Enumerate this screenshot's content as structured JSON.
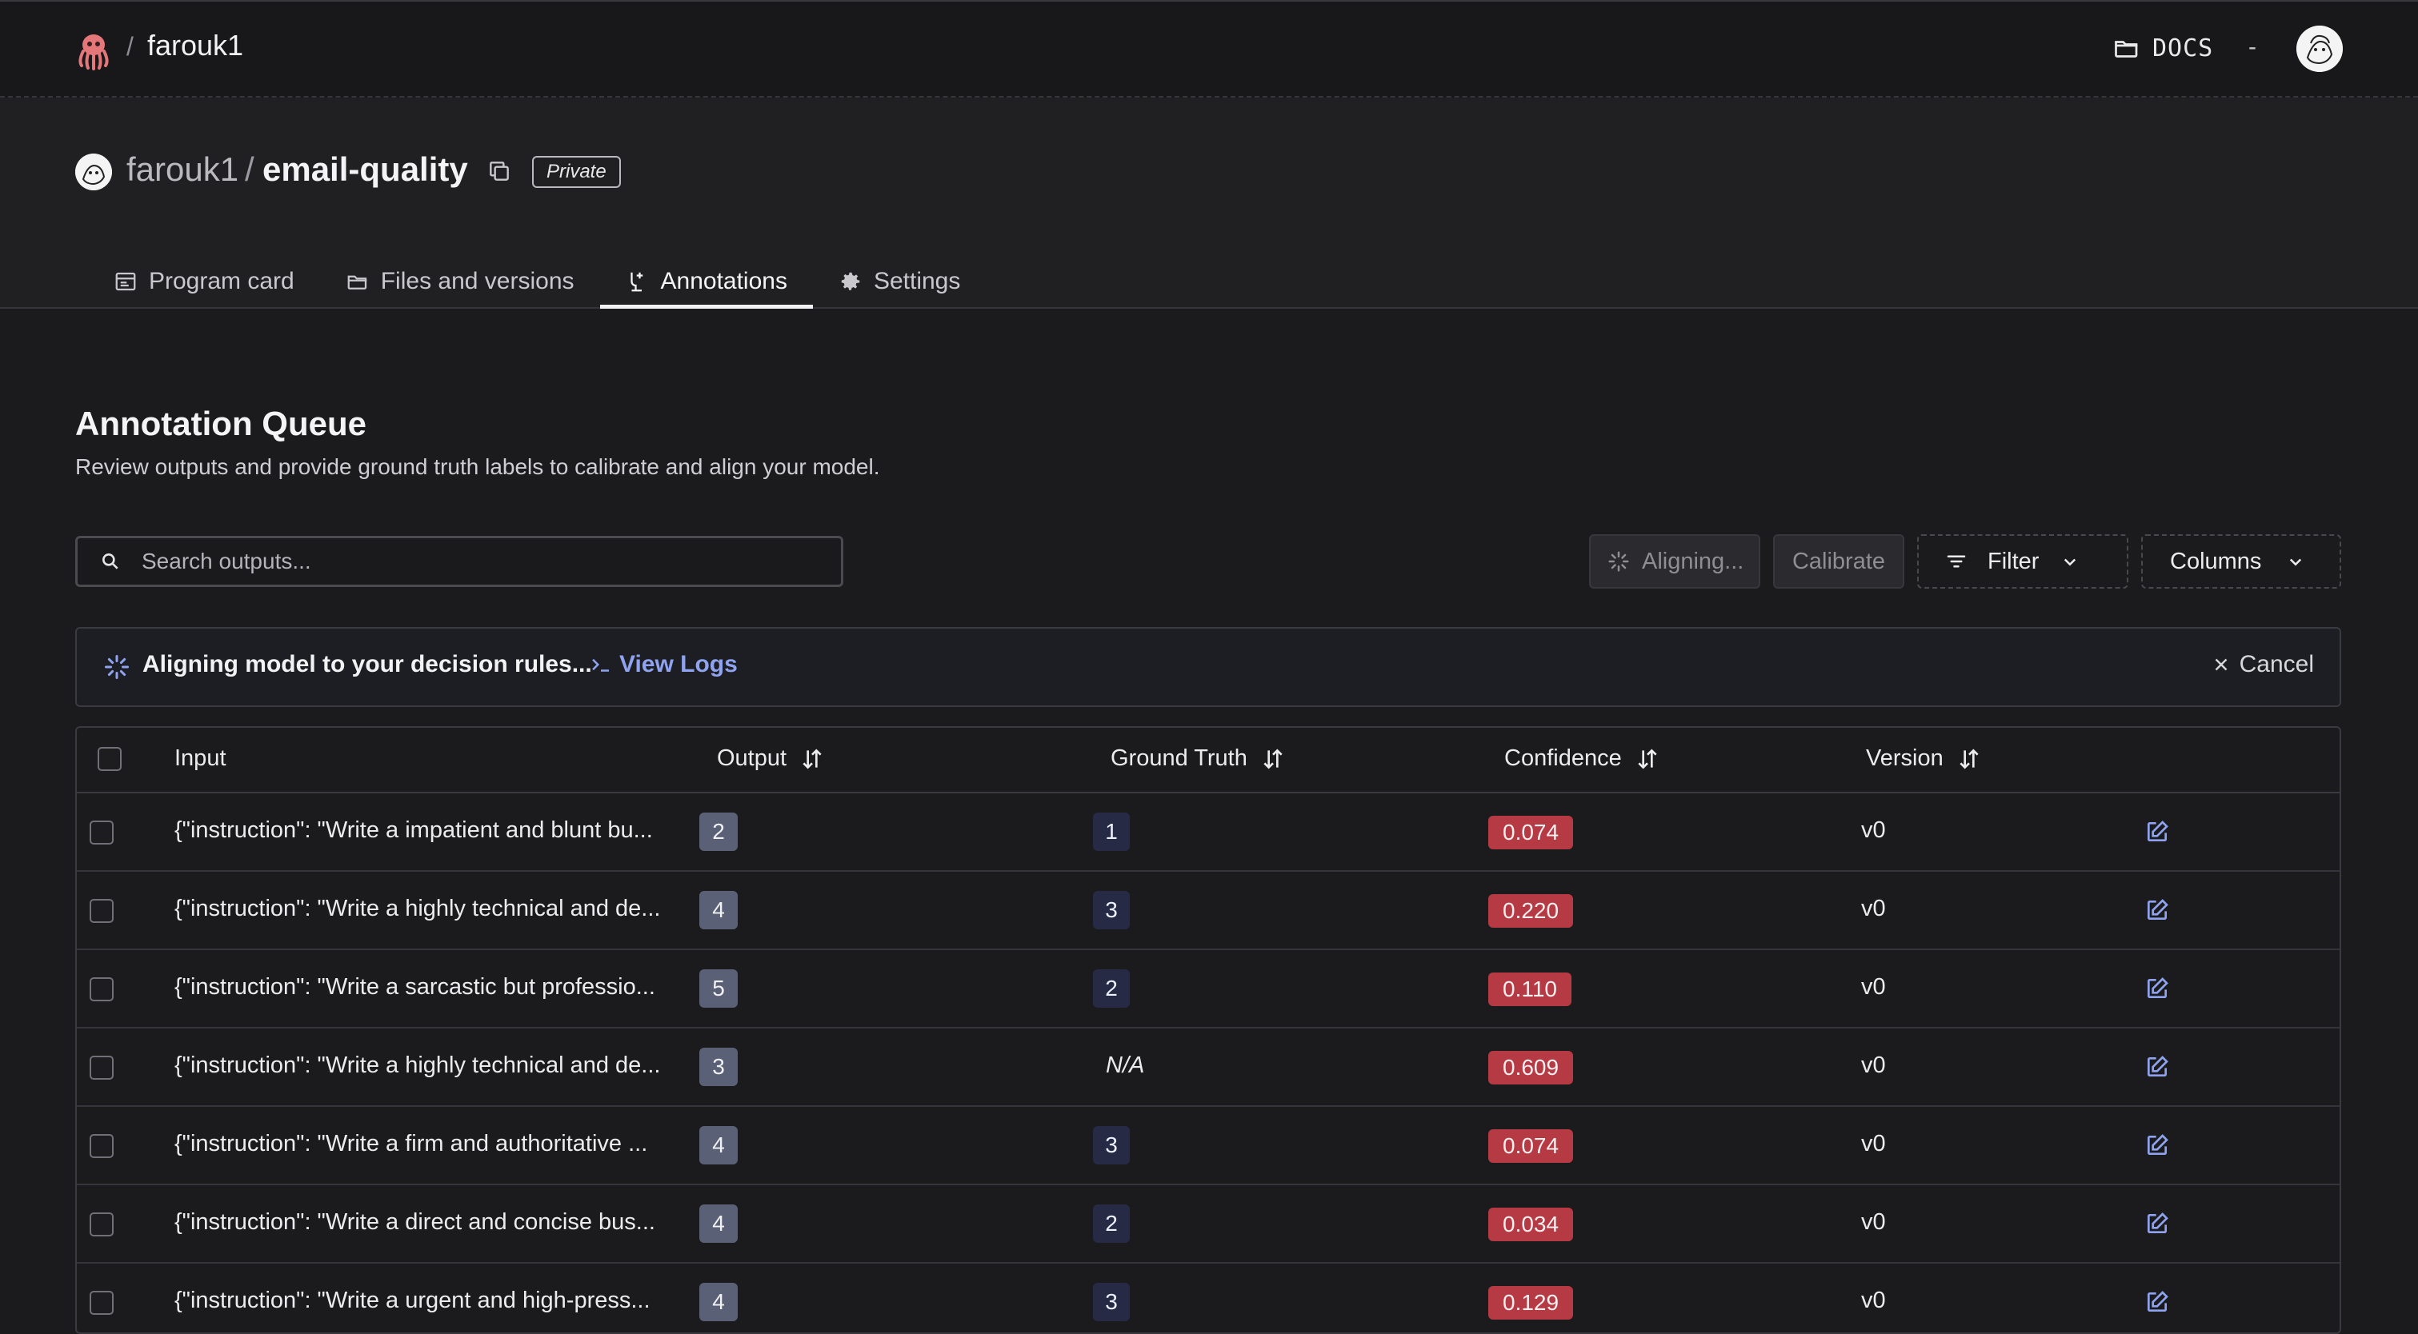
{
  "topnav": {
    "user": "farouk1",
    "docs_label": "DOCS",
    "dash": "-"
  },
  "repo": {
    "owner": "farouk1",
    "separator": "/",
    "name": "email-quality",
    "visibility": "Private"
  },
  "tabs": [
    {
      "label": "Program card",
      "icon": "card-icon"
    },
    {
      "label": "Files and versions",
      "icon": "folder-icon"
    },
    {
      "label": "Annotations",
      "icon": "annotation-icon",
      "active": true
    },
    {
      "label": "Settings",
      "icon": "gear-icon"
    }
  ],
  "main": {
    "title": "Annotation Queue",
    "subtitle": "Review outputs and provide ground truth labels to calibrate and align your model."
  },
  "search": {
    "placeholder": "Search outputs..."
  },
  "toolbar": {
    "aligning_label": "Aligning...",
    "calibrate_label": "Calibrate",
    "filter_label": "Filter",
    "columns_label": "Columns"
  },
  "banner": {
    "message": "Aligning model to your decision rules...",
    "logs_label": "View Logs",
    "cancel_label": "Cancel"
  },
  "table": {
    "headers": {
      "input": "Input",
      "output": "Output",
      "ground_truth": "Ground Truth",
      "confidence": "Confidence",
      "version": "Version"
    },
    "rows": [
      {
        "input": "{\"instruction\": \"Write a impatient and blunt bu...",
        "output": "2",
        "ground_truth": "1",
        "confidence": "0.074",
        "version": "v0"
      },
      {
        "input": "{\"instruction\": \"Write a highly technical and de...",
        "output": "4",
        "ground_truth": "3",
        "confidence": "0.220",
        "version": "v0"
      },
      {
        "input": "{\"instruction\": \"Write a sarcastic but professio...",
        "output": "5",
        "ground_truth": "2",
        "confidence": "0.110",
        "version": "v0"
      },
      {
        "input": "{\"instruction\": \"Write a highly technical and de...",
        "output": "3",
        "ground_truth": "N/A",
        "confidence": "0.609",
        "version": "v0"
      },
      {
        "input": "{\"instruction\": \"Write a firm and authoritative ...",
        "output": "4",
        "ground_truth": "3",
        "confidence": "0.074",
        "version": "v0"
      },
      {
        "input": "{\"instruction\": \"Write a direct and concise bus...",
        "output": "4",
        "ground_truth": "2",
        "confidence": "0.034",
        "version": "v0"
      },
      {
        "input": "{\"instruction\": \"Write a urgent and high-press...",
        "output": "4",
        "ground_truth": "3",
        "confidence": "0.129",
        "version": "v0"
      }
    ]
  },
  "colors": {
    "accent_link": "#8fa3ef",
    "confidence_badge": "#b63a44",
    "output_badge": "#5a6076",
    "ground_truth_badge": "#262a45"
  }
}
